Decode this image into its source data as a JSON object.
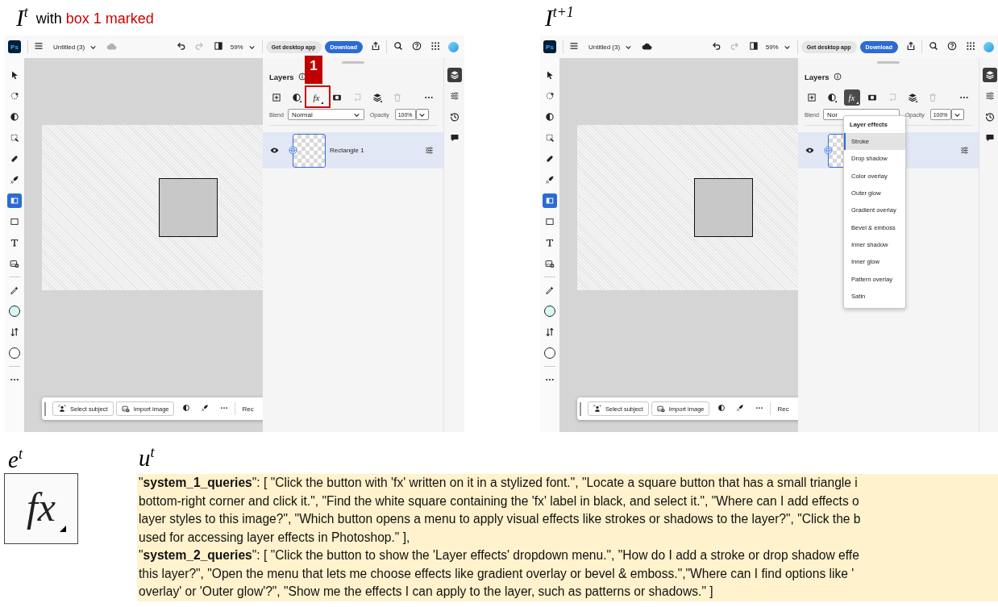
{
  "header": {
    "current_label": "I$^{t}$",
    "caption_prefix": "with",
    "caption_marked": "box 1 marked",
    "next_label": "I$^{t+1}$"
  },
  "screens": [
    {
      "app_badge": "Ps",
      "document_title": "Untitled (3)",
      "cloud_synced": false,
      "redo_disabled": true,
      "zoom": "59%",
      "get_app_button": "Get desktop app",
      "download_button": "Download",
      "tool_groups": [
        [
          {
            "kind": "select",
            "selected": false
          },
          {
            "kind": "lasso",
            "selected": false
          },
          {
            "kind": "adjust",
            "selected": false
          },
          {
            "kind": "crop",
            "selected": false
          },
          {
            "kind": "heal",
            "selected": false
          },
          {
            "kind": "quick",
            "selected": false
          },
          {
            "kind": "gradient",
            "selected": true
          },
          {
            "kind": "shape",
            "selected": false
          },
          {
            "kind": "type",
            "selected": false
          },
          {
            "kind": "place",
            "selected": false
          }
        ],
        [
          {
            "kind": "eyedropper",
            "selected": false
          },
          {
            "kind": "swatch",
            "color": "#d8f8f4",
            "selected": false
          },
          {
            "kind": "swap",
            "selected": false
          },
          {
            "kind": "swatch",
            "color": "#ffffff",
            "selected": false
          }
        ],
        [
          {
            "kind": "more",
            "selected": false
          }
        ]
      ],
      "layers_panel": {
        "title": "Layers",
        "effects_button": {
          "label": "fx",
          "selected": false
        },
        "blend_label": "Blend",
        "blend_value": "Normal",
        "opacity_label": "Opacity",
        "opacity_value": "100%",
        "layers": [
          {
            "name": "Rectangle 1",
            "selected": true
          }
        ],
        "marked": {
          "label": "1"
        }
      },
      "rail": [
        {
          "kind": "layers",
          "selected": true
        },
        {
          "kind": "properties",
          "selected": false
        },
        {
          "kind": "history",
          "selected": false
        },
        {
          "kind": "comments",
          "selected": false
        }
      ],
      "task_bar": {
        "buttons": [
          {
            "kind": "subject",
            "label": "Select subject"
          },
          {
            "kind": "import",
            "label": "Import image"
          }
        ],
        "overflow_text": "Rec"
      }
    },
    {
      "app_badge": "Ps",
      "document_title": "Untitled (3)",
      "cloud_synced": true,
      "redo_disabled": true,
      "zoom": "59%",
      "get_app_button": "Get desktop app",
      "download_button": "Download",
      "tool_groups": [
        [
          {
            "kind": "select",
            "selected": false
          },
          {
            "kind": "lasso",
            "selected": false
          },
          {
            "kind": "adjust",
            "selected": false
          },
          {
            "kind": "crop",
            "selected": false
          },
          {
            "kind": "heal",
            "selected": false
          },
          {
            "kind": "quick",
            "selected": false
          },
          {
            "kind": "gradient",
            "selected": true
          },
          {
            "kind": "shape",
            "selected": false
          },
          {
            "kind": "type",
            "selected": false
          },
          {
            "kind": "place",
            "selected": false
          }
        ],
        [
          {
            "kind": "eyedropper",
            "selected": false
          },
          {
            "kind": "swatch",
            "color": "#d8f8f4",
            "selected": false
          },
          {
            "kind": "swap",
            "selected": false
          },
          {
            "kind": "swatch",
            "color": "#ffffff",
            "selected": false
          }
        ],
        [
          {
            "kind": "more",
            "selected": false
          }
        ]
      ],
      "layers_panel": {
        "title": "Layers",
        "effects_button": {
          "label": "fx",
          "selected": true
        },
        "blend_label": "Blend",
        "blend_value": "Nor",
        "opacity_label": "Opacity",
        "opacity_value": "100%",
        "layers": [
          {
            "selected": true
          }
        ]
      },
      "effects_menu": {
        "title": "Layer effects",
        "items": [
          {
            "label": "Stroke",
            "selected": true
          },
          {
            "label": "Drop shadow",
            "selected": false
          },
          {
            "label": "Color overlay",
            "selected": false
          },
          {
            "label": "Outer glow",
            "selected": false
          },
          {
            "label": "Gradient overlay",
            "selected": false
          },
          {
            "label": "Bevel & emboss",
            "selected": false
          },
          {
            "label": "Inner shadow",
            "selected": false
          },
          {
            "label": "Inner glow",
            "selected": false
          },
          {
            "label": "Pattern overlay",
            "selected": false
          },
          {
            "label": "Satin",
            "selected": false
          }
        ]
      },
      "rail": [
        {
          "kind": "layers",
          "selected": true
        },
        {
          "kind": "properties",
          "selected": false
        },
        {
          "kind": "history",
          "selected": false
        },
        {
          "kind": "comments",
          "selected": false
        }
      ],
      "task_bar": {
        "buttons": [
          {
            "kind": "subject",
            "label": "Select subject"
          },
          {
            "kind": "import",
            "label": "Import image"
          }
        ],
        "overflow_text": "Rec"
      }
    }
  ],
  "example": {
    "element_label": "e$^{t}$",
    "element_text": "fx",
    "utterance_label": "u$^{t}$",
    "utterance_lines": [
      "\"**system_1_queries**\": [ \"Click the button with 'fx' written on it in a stylized font.\", \"Locate a square button that has a small triangle i",
      "bottom-right corner and click it.\", \"Find the white square containing the 'fx' label in black, and select it.\", \"Where can I add effects o",
      "layer styles to this image?\", \"Which button opens a menu to apply visual effects like strokes or shadows to the layer?\", \"Click the b",
      "used for accessing layer effects in Photoshop.\" ],",
      "\"**system_2_queries**\": [ \"Click the button to show the 'Layer effects' dropdown menu.\", \"How do I add a stroke or drop shadow effe",
      "this layer?\", \"Open the menu that lets me choose effects like gradient overlay or bevel & emboss.\",\"Where can I find options like '",
      "overlay' or 'Outer glow'?\", \"Show me the effects I can apply to the layer, such as patterns or shadows.\" ]"
    ]
  }
}
